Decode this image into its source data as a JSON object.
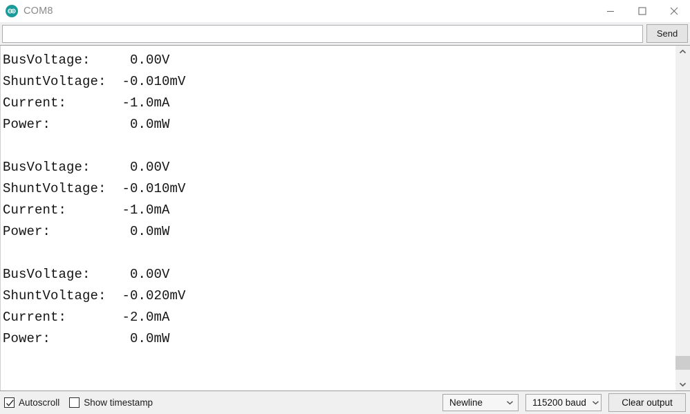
{
  "window": {
    "title": "COM8",
    "logo_icon": "arduino-infinity-icon",
    "controls": {
      "minimize": "minimize-icon",
      "maximize": "maximize-icon",
      "close": "close-icon"
    }
  },
  "send_bar": {
    "input_value": "",
    "input_placeholder": "",
    "send_label": "Send"
  },
  "output": {
    "lines": [
      "BusVoltage:     0.00V",
      "ShuntVoltage:  -0.010mV",
      "Current:       -1.0mA",
      "Power:          0.0mW",
      "",
      "BusVoltage:     0.00V",
      "ShuntVoltage:  -0.010mV",
      "Current:       -1.0mA",
      "Power:          0.0mW",
      "",
      "BusVoltage:     0.00V",
      "ShuntVoltage:  -0.020mV",
      "Current:       -2.0mA",
      "Power:          0.0mW"
    ],
    "readings": [
      {
        "bus_voltage_label": "BusVoltage:",
        "bus_voltage_value": "0.00V",
        "shunt_voltage_label": "ShuntVoltage:",
        "shunt_voltage_value": "-0.010mV",
        "current_label": "Current:",
        "current_value": "-1.0mA",
        "power_label": "Power:",
        "power_value": "0.0mW"
      },
      {
        "bus_voltage_label": "BusVoltage:",
        "bus_voltage_value": "0.00V",
        "shunt_voltage_label": "ShuntVoltage:",
        "shunt_voltage_value": "-0.010mV",
        "current_label": "Current:",
        "current_value": "-1.0mA",
        "power_label": "Power:",
        "power_value": "0.0mW"
      },
      {
        "bus_voltage_label": "BusVoltage:",
        "bus_voltage_value": "0.00V",
        "shunt_voltage_label": "ShuntVoltage:",
        "shunt_voltage_value": "-0.020mV",
        "current_label": "Current:",
        "current_value": "-2.0mA",
        "power_label": "Power:",
        "power_value": "0.0mW"
      }
    ]
  },
  "scrollbar": {
    "up_icon": "chevron-up-icon",
    "down_icon": "chevron-down-icon",
    "thumb_top_pct": 93,
    "thumb_height_pct": 4.5
  },
  "status_bar": {
    "autoscroll_label": "Autoscroll",
    "autoscroll_checked": true,
    "timestamp_label": "Show timestamp",
    "timestamp_checked": false,
    "line_ending": "Newline",
    "baud_rate": "115200 baud",
    "clear_label": "Clear output"
  },
  "colors": {
    "accent": "#1a9a9a",
    "chrome": "#f0f0f0",
    "text": "#141414",
    "title_text": "#8a8a8a"
  }
}
